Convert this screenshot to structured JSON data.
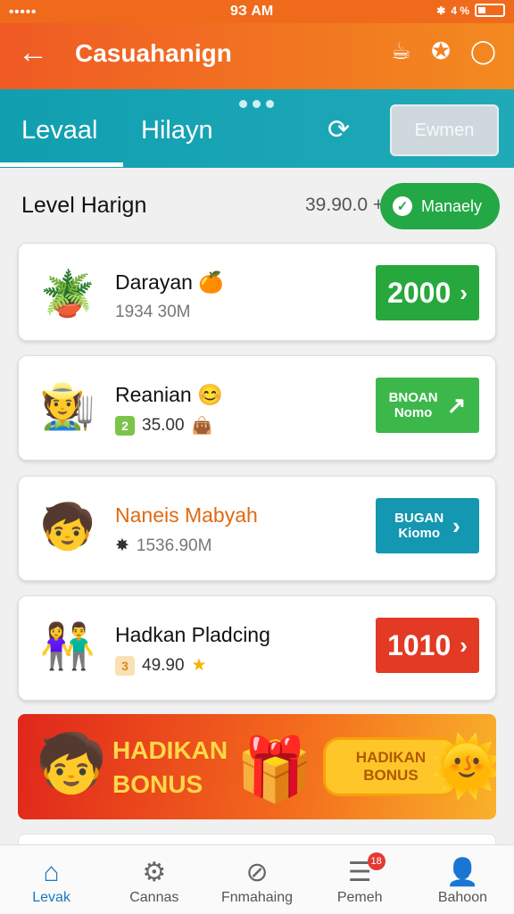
{
  "status_bar": {
    "signal": "•••••",
    "time": "9З АМ",
    "battery_text": "4 %"
  },
  "app_bar": {
    "title": "Casuahanign",
    "back_icon": "arrow-left-icon",
    "action_icons": [
      "cup-icon",
      "bell-icon",
      "chat-icon"
    ]
  },
  "tabs": {
    "items": [
      {
        "label": "Levaal"
      },
      {
        "label": "Hilayn"
      }
    ],
    "button": "Ewmen"
  },
  "section": {
    "title": "Level Harign",
    "count": "39.90.0 +",
    "manage": "Manaely"
  },
  "rows": [
    {
      "name": "Darayan",
      "meta": "1934 30M",
      "action_big": "2000",
      "action_color": "#27a83c",
      "name_color": "#111111"
    },
    {
      "name": "Reanian",
      "meta": "35.00",
      "badge": "2",
      "badge_color": "#7cc34a",
      "action_line1": "BNOAN",
      "action_line2": "Nomo",
      "action_color": "#3cb84a",
      "name_color": "#111111"
    },
    {
      "name": "Naneis Mabyah",
      "meta": "1536.90M",
      "action_line1": "BUGAN",
      "action_line2": "Kiomo",
      "action_color": "#1497b0",
      "name_color": "#e06a12"
    },
    {
      "name": "Hadkan Pladcing",
      "meta": "49.90",
      "badge": "3",
      "badge_color": "#f1b24a",
      "action_big": "1010",
      "action_color": "#e23a25",
      "name_color": "#111111"
    }
  ],
  "banner": {
    "line1": "HADIKAN",
    "line2": "BONUS",
    "pill_line1": "HADIKAN",
    "pill_line2": "BONUS"
  },
  "bottom_nav": [
    {
      "label": "Levak",
      "icon": "home-icon",
      "active": true
    },
    {
      "label": "Cannas",
      "icon": "gear-icon"
    },
    {
      "label": "Fnmahaing",
      "icon": "block-icon"
    },
    {
      "label": "Pemeh",
      "icon": "inbox-icon",
      "badge": "18"
    },
    {
      "label": "Bahoon",
      "icon": "user-icon"
    }
  ]
}
